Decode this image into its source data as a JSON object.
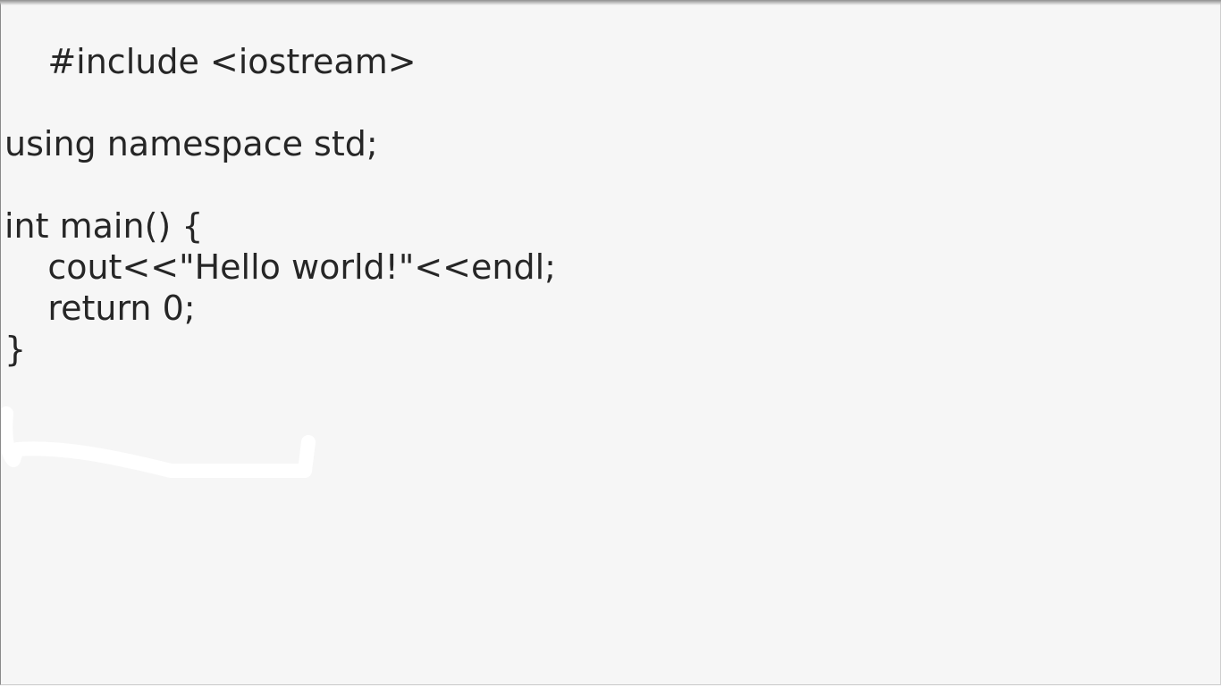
{
  "editor": {
    "lines": [
      "    #include <iostream>",
      "",
      "using namespace std;",
      "",
      "int main() {",
      "    cout<<\"Hello world!\"<<endl;",
      "    return 0;",
      "}"
    ]
  },
  "colors": {
    "background": "#f6f6f6",
    "text": "#262626",
    "mark": "#ffffff"
  }
}
